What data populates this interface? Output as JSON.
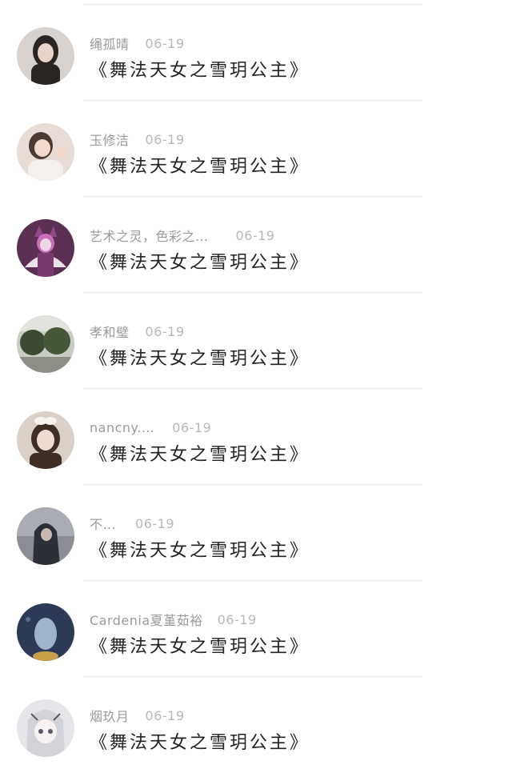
{
  "comments": [
    {
      "name": "绳孤晴",
      "date": "06-19",
      "content": "《舞法天女之雪玥公主》",
      "avatar_icon": "girl-photo-avatar-icon",
      "avatar_bg": "#d8d2cf",
      "avatar_fg": "#2a2422"
    },
    {
      "name": "玉修洁",
      "date": "06-19",
      "content": "《舞法天女之雪玥公主》",
      "avatar_icon": "child-photo-avatar-icon",
      "avatar_bg": "#e8dcd6",
      "avatar_fg": "#4a3a33"
    },
    {
      "name": "艺术之灵，色彩之…",
      "date": "06-19",
      "content": "《舞法天女之雪玥公主》",
      "avatar_icon": "costume-character-avatar-icon",
      "avatar_bg": "#5a2f52",
      "avatar_fg": "#c86fb8"
    },
    {
      "name": "孝和璧",
      "date": "06-19",
      "content": "《舞法天女之雪玥公主》",
      "avatar_icon": "trees-photo-avatar-icon",
      "avatar_bg": "#c9ccc4",
      "avatar_fg": "#3c4a33"
    },
    {
      "name": "nancny.…",
      "date": "06-19",
      "content": "《舞法天女之雪玥公主》",
      "avatar_icon": "girl-bow-avatar-icon",
      "avatar_bg": "#d9d0c8",
      "avatar_fg": "#3e2e26"
    },
    {
      "name": "不…",
      "date": "06-19",
      "content": "《舞法天女之雪玥公主》",
      "avatar_icon": "hooded-figure-avatar-icon",
      "avatar_bg": "#8a8e94",
      "avatar_fg": "#2c2f35"
    },
    {
      "name": "Cardenia夏堇茹裕",
      "date": "06-19",
      "content": "《舞法天女之雪玥公主》",
      "avatar_icon": "blue-scene-avatar-icon",
      "avatar_bg": "#2c3a55",
      "avatar_fg": "#9fb4c8"
    },
    {
      "name": "烟玖月",
      "date": "06-19",
      "content": "《舞法天女之雪玥公主》",
      "avatar_icon": "anime-girl-avatar-icon",
      "avatar_bg": "#e6e6ea",
      "avatar_fg": "#5a5a66"
    }
  ]
}
